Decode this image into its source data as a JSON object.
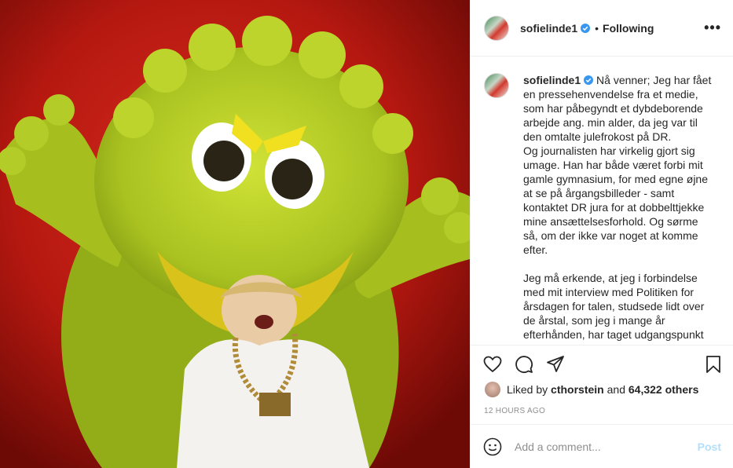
{
  "post": {
    "username": "sofielinde1",
    "separator": "•",
    "follow_status": "Following",
    "more_label": "•••",
    "caption": [
      "Nå venner; Jeg har fået en pressehenvendelse fra et medie, som har påbegyndt et dybdeborende arbejde ang. min alder, da jeg var til den omtalte julefrokost på DR.",
      "Og journalisten har virkelig gjort sig umage. Han har både været forbi mit gamle gymnasium, for med egne øjne at se på årgangsbilleder - samt kontaktet DR jura for at dobbelttjekke mine ansættelsesforhold. Og sørme så, om der ikke var noget at komme efter.",
      "Jeg må erkende, at jeg i forbindelse med mit interview med Politiken for årsdagen for talen, studsede lidt over de årstal, som jeg i mange år efterhånden, har taget udgangspunkt"
    ],
    "liked_by_prefix": "Liked by",
    "liked_by_user": "cthorstein",
    "liked_by_and": "and",
    "likes_count": "64,322 others",
    "timestamp": "12 HOURS AGO",
    "comment_placeholder": "Add a comment...",
    "post_button": "Post"
  },
  "icons": [
    "heart-icon",
    "comment-icon",
    "share-icon",
    "bookmark-icon",
    "emoji-icon",
    "verified-icon",
    "more-icon"
  ],
  "colors": {
    "verified": "#3897f0",
    "post_disabled": "#b2dffc",
    "meta_gray": "#8e8e8e",
    "frog_green": "#b5cf25",
    "background_red": "#c21d14"
  }
}
